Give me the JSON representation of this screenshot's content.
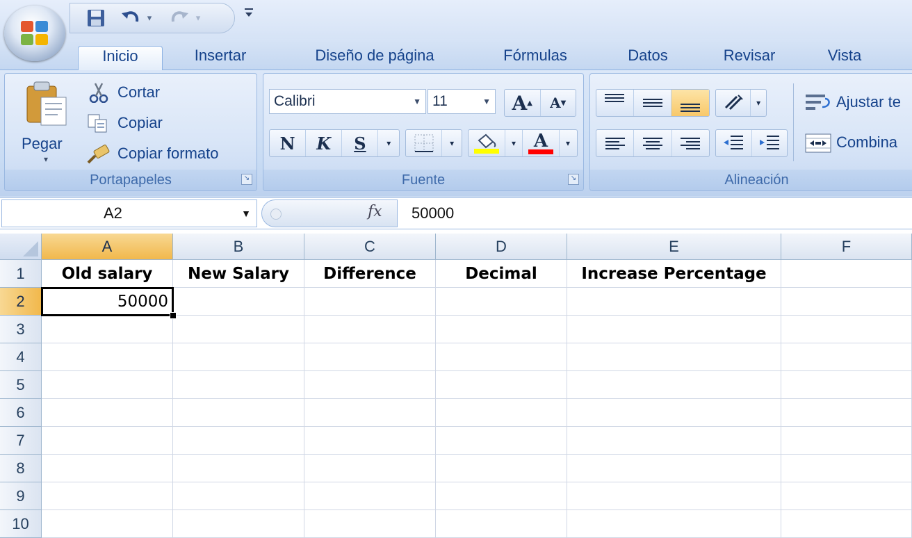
{
  "tabs": [
    "Inicio",
    "Insertar",
    "Diseño de página",
    "Fórmulas",
    "Datos",
    "Revisar",
    "Vista"
  ],
  "active_tab": "Inicio",
  "clipboard": {
    "paste_label": "Pegar",
    "cut_label": "Cortar",
    "copy_label": "Copiar",
    "format_painter_label": "Copiar formato",
    "group_label": "Portapapeles"
  },
  "font": {
    "font_name": "Calibri",
    "font_size": "11",
    "bold_label": "N",
    "italic_label": "K",
    "underline_label": "S",
    "grow_label": "A",
    "shrink_label": "A",
    "font_color_label": "A",
    "group_label": "Fuente",
    "highlight_color": "#ffff00",
    "font_color": "#ff0000"
  },
  "alignment": {
    "wrap_text_label": "Ajustar te",
    "merge_label": "Combina",
    "group_label": "Alineación"
  },
  "formula_bar": {
    "name_box": "A2",
    "fx_label": "fx",
    "formula": "50000"
  },
  "sheet": {
    "columns": [
      "A",
      "B",
      "C",
      "D",
      "E",
      "F"
    ],
    "rows": [
      "1",
      "2",
      "3",
      "4",
      "5",
      "6",
      "7",
      "8",
      "9",
      "10"
    ],
    "selected_column": "A",
    "selected_row": "2",
    "row1": {
      "A": "Old salary",
      "B": "New Salary",
      "C": "Difference",
      "D": "Decimal",
      "E": "Increase Percentage"
    },
    "row2": {
      "A": "50000"
    }
  },
  "colors": {
    "ribbon_text": "#15428b",
    "selected_header": "#f1b84c",
    "grid_line": "#d0d7e5"
  }
}
